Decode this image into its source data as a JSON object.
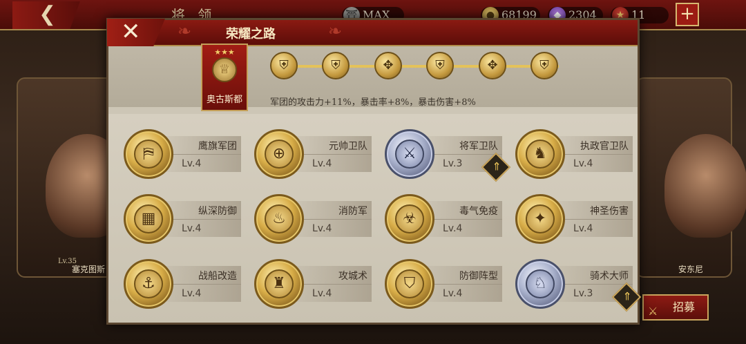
{
  "topbar": {
    "back_icon": "back-arrow-icon",
    "title": "将 领",
    "resources": [
      {
        "icon": "temple-icon",
        "value": "MAX"
      },
      {
        "icon": "gold-coin-icon",
        "value": "68199"
      },
      {
        "icon": "purple-gem-icon",
        "value": "2304"
      },
      {
        "icon": "medal-icon",
        "value": "11"
      }
    ],
    "plus_label": "+"
  },
  "heroes": {
    "left": {
      "name": "塞克图斯",
      "level": "Lv.35"
    },
    "right": {
      "name": "安东尼"
    }
  },
  "recruit": {
    "label": "招募"
  },
  "modal": {
    "title": "荣耀之路",
    "close_label": "✕",
    "banner": {
      "stars": "★★★",
      "name": "奥古斯都"
    },
    "path_nodes": [
      "⛨",
      "⛨",
      "✥",
      "⛨",
      "✥",
      "⛨"
    ],
    "bonus_text": "军团的攻击力+11%，暴击率+8%，暴击伤害+8%",
    "skills": [
      {
        "name": "鹰旗军团",
        "level": "Lv.4",
        "tier": "gold",
        "glyph": "⛿",
        "upgradable": false
      },
      {
        "name": "元帅卫队",
        "level": "Lv.4",
        "tier": "gold",
        "glyph": "⊕",
        "upgradable": false
      },
      {
        "name": "将军卫队",
        "level": "Lv.3",
        "tier": "silver",
        "glyph": "⚔",
        "upgradable": true
      },
      {
        "name": "执政官卫队",
        "level": "Lv.4",
        "tier": "gold",
        "glyph": "♞",
        "upgradable": false
      },
      {
        "name": "纵深防御",
        "level": "Lv.4",
        "tier": "gold",
        "glyph": "▦",
        "upgradable": false
      },
      {
        "name": "消防军",
        "level": "Lv.4",
        "tier": "gold",
        "glyph": "♨",
        "upgradable": false
      },
      {
        "name": "毒气免疫",
        "level": "Lv.4",
        "tier": "gold",
        "glyph": "☣",
        "upgradable": false
      },
      {
        "name": "神圣伤害",
        "level": "Lv.4",
        "tier": "gold",
        "glyph": "✦",
        "upgradable": false
      },
      {
        "name": "战船改造",
        "level": "Lv.4",
        "tier": "gold",
        "glyph": "⚓",
        "upgradable": false
      },
      {
        "name": "攻城术",
        "level": "Lv.4",
        "tier": "gold",
        "glyph": "♜",
        "upgradable": false
      },
      {
        "name": "防御阵型",
        "level": "Lv.4",
        "tier": "gold",
        "glyph": "⛉",
        "upgradable": false
      },
      {
        "name": "骑术大师",
        "level": "Lv.3",
        "tier": "silver",
        "glyph": "♘",
        "upgradable": true
      }
    ],
    "upgrade_arrow": "⇑"
  },
  "colors": {
    "header_red": "#8a1a12",
    "gold": "#d8ad48",
    "silver": "#a9b1cc",
    "panel_bg": "#cdc6b6"
  }
}
